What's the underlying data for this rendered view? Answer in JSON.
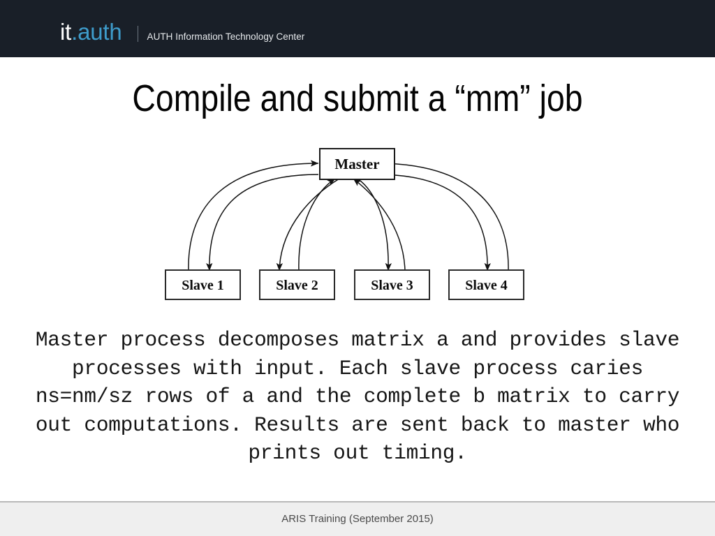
{
  "header": {
    "brand_primary": "it",
    "brand_accent": ".auth",
    "subtitle": "AUTH Information Technology Center",
    "background_color": "#191f28",
    "accent_color": "#3e9ccb"
  },
  "slide": {
    "title": "Compile and submit a “mm” job"
  },
  "diagram": {
    "type": "master-slave-topology",
    "master": {
      "label": "Master"
    },
    "slaves": [
      {
        "label": "Slave 1"
      },
      {
        "label": "Slave 2"
      },
      {
        "label": "Slave 3"
      },
      {
        "label": "Slave 4"
      }
    ],
    "edge_style": "curved bidirectional arrows between master and each slave",
    "line_color": "#1a1a1a",
    "box_fill": "#ffffff"
  },
  "body": {
    "paragraph": "Master process decomposes matrix a and provides slave processes with input. Each slave process caries ns=nm/sz rows of a and the complete b matrix to carry out computations. Results are sent back to master who prints out timing."
  },
  "footer": {
    "text": "ARIS Training (September 2015)",
    "background_color": "#efefef"
  }
}
